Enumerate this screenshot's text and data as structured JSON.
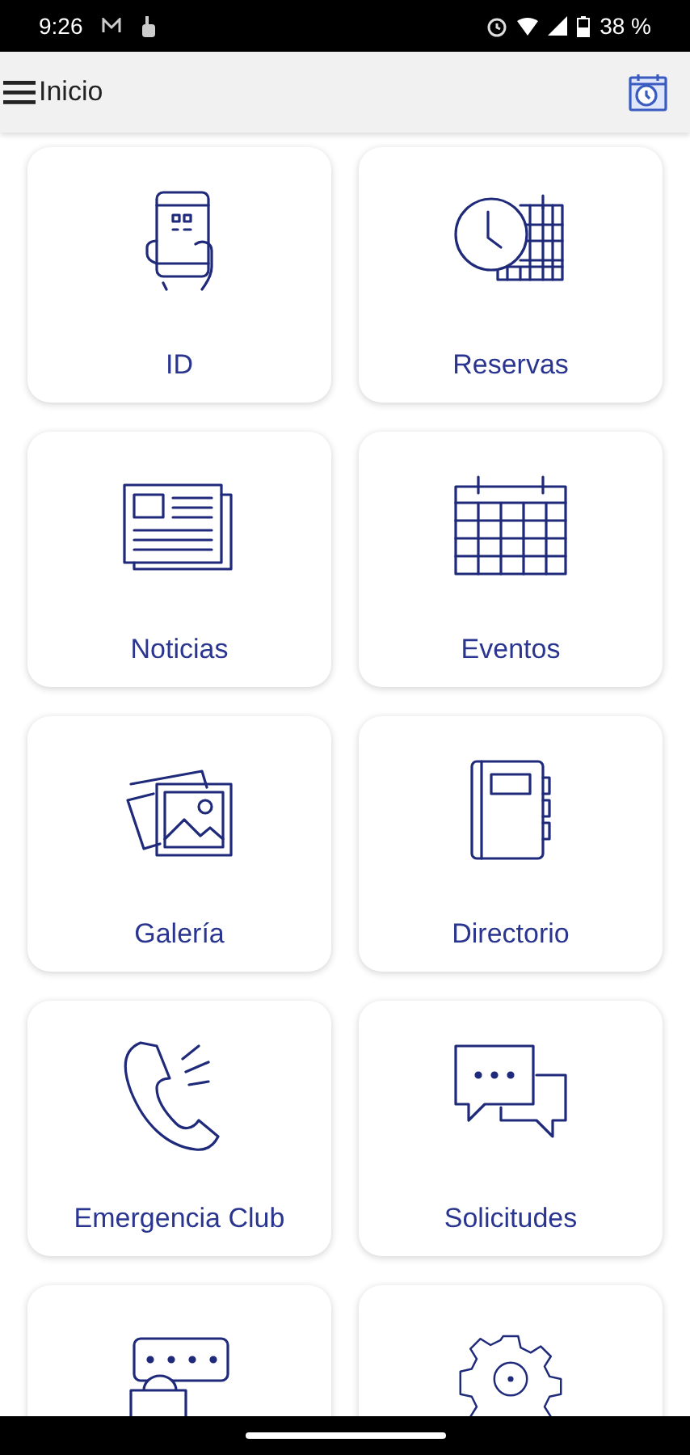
{
  "status_bar": {
    "time": "9:26",
    "battery": "38 %"
  },
  "app_bar": {
    "title": "Inicio"
  },
  "tiles": [
    {
      "kind": "phone",
      "label": "ID"
    },
    {
      "kind": "clock",
      "label": "Reservas"
    },
    {
      "kind": "news",
      "label": "Noticias"
    },
    {
      "kind": "calendar",
      "label": "Eventos"
    },
    {
      "kind": "gallery",
      "label": "Galería"
    },
    {
      "kind": "notebook",
      "label": "Directorio"
    },
    {
      "kind": "call",
      "label": "Emergencia Club"
    },
    {
      "kind": "chat",
      "label": "Solicitudes"
    },
    {
      "kind": "lock"
    },
    {
      "kind": "settings"
    }
  ]
}
